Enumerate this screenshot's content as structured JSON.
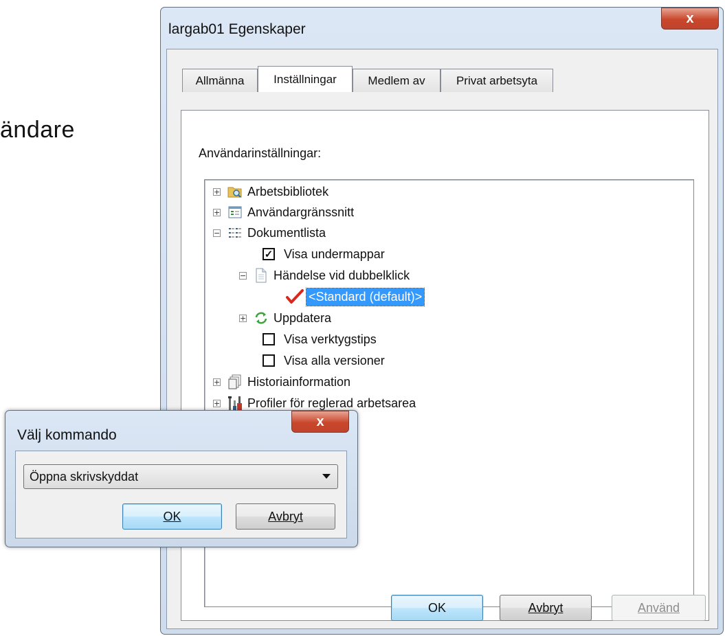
{
  "background_text": "ändare",
  "main_window": {
    "title": "largab01 Egenskaper",
    "close_glyph": "x",
    "tabs": [
      {
        "label": "Allmänna"
      },
      {
        "label": "Inställningar"
      },
      {
        "label": "Medlem av"
      },
      {
        "label": "Privat arbetsyta"
      }
    ],
    "active_tab": "Inställningar",
    "section_label": "Användarinställningar:",
    "tree": [
      {
        "label": "Arbetsbibliotek",
        "icon": "folder-search-icon",
        "expander": "+"
      },
      {
        "label": "Användargränssnitt",
        "icon": "window-list-icon",
        "expander": "+"
      },
      {
        "label": "Dokumentlista",
        "icon": "list-icon",
        "expander": "−"
      },
      {
        "label": "Visa undermappar",
        "checked": true
      },
      {
        "label": "Händelse vid dubbelklick",
        "icon": "document-icon",
        "expander": "−"
      },
      {
        "label": "<Standard (default)>",
        "icon": "red-check-icon",
        "selected": true
      },
      {
        "label": "Uppdatera",
        "icon": "refresh-icon",
        "expander": "+"
      },
      {
        "label": "Visa verktygstips",
        "checked": false
      },
      {
        "label": "Visa alla versioner",
        "checked": false
      },
      {
        "label": "Historiainformation",
        "icon": "pages-icon",
        "expander": "+"
      },
      {
        "label": "Profiler för reglerad arbetsarea",
        "icon": "tools-icon",
        "expander": "+"
      }
    ],
    "buttons": {
      "ok": "OK",
      "cancel": "Avbryt",
      "apply": "Använd"
    }
  },
  "command_dialog": {
    "title": "Välj kommando",
    "close_glyph": "x",
    "selected_command": "Öppna skrivskyddat",
    "buttons": {
      "ok": "OK",
      "cancel": "Avbryt"
    }
  },
  "colors": {
    "selection": "#3399ff",
    "close_button": "#c9472c",
    "check_mark": "#d9281b",
    "refresh": "#3aa63a"
  }
}
